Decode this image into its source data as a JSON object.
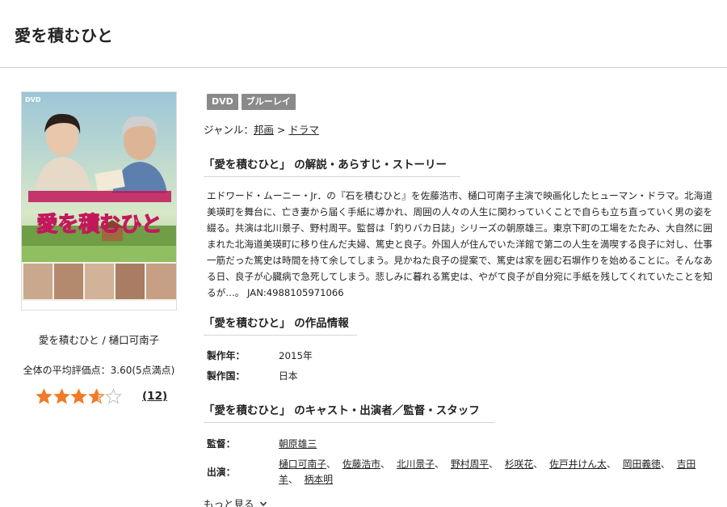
{
  "header": {
    "title": "愛を積むひと"
  },
  "poster": {
    "format_mark": "DVD",
    "title_text": "愛を積むひと"
  },
  "sidebar": {
    "caption": "愛を積むひと / 樋口可南子",
    "avg_rating_text": "全体の平均評価点：3.60(5点満点)",
    "rating": {
      "value": 3.6,
      "max": 5
    },
    "review_count": "12",
    "colors": {
      "star_fill": "#f07a28",
      "star_empty": "#bdbdbd"
    }
  },
  "badges": [
    "DVD",
    "ブルーレイ"
  ],
  "genre": {
    "label": "ジャンル：",
    "items": [
      "邦画",
      "ドラマ"
    ],
    "separator": ">"
  },
  "sections": {
    "story_heading": "「愛を積むひと」 の解説・あらすじ・ストーリー",
    "info_heading": "「愛を積むひと」 の作品情報",
    "cast_heading": "「愛を積むひと」 のキャスト・出演者／監督・スタッフ"
  },
  "synopsis": "エドワード・ムーニー・Jr．の『石を積むひと』を佐藤浩市、樋口可南子主演で映画化したヒューマン・ドラマ。北海道美瑛町を舞台に、亡き妻から届く手紙に導かれ、周囲の人々の人生に関わっていくことで自らも立ち直っていく男の姿を綴る。共演は北川景子、野村周平。監督は「釣りバカ日誌」シリーズの朝原雄三。東京下町の工場をたたみ、大自然に囲まれた北海道美瑛町に移り住んだ夫婦、篤史と良子。外国人が住んでいた洋館で第二の人生を満喫する良子に対し、仕事一筋だった篤史は時間を持て余してしまう。見かねた良子の提案で、篤史は家を囲む石塀作りを始めることに。そんなある日、良子が心臓病で急死してしまう。悲しみに暮れる篤史は、やがて良子が自分宛に手紙を残してくれていたことを知るが…。 JAN:4988105971066",
  "info": {
    "year_label": "製作年：",
    "year": "2015年",
    "country_label": "製作国：",
    "country": "日本"
  },
  "cast": {
    "director_label": "監督：",
    "director": "朝原雄三",
    "cast_label": "出演：",
    "members": [
      "樋口可南子",
      "佐藤浩市",
      "北川景子",
      "野村周平",
      "杉咲花",
      "佐戸井けん太",
      "岡田義徳",
      "吉田羊",
      "柄本明"
    ],
    "separator": "、"
  },
  "more_label": "もっと見る"
}
